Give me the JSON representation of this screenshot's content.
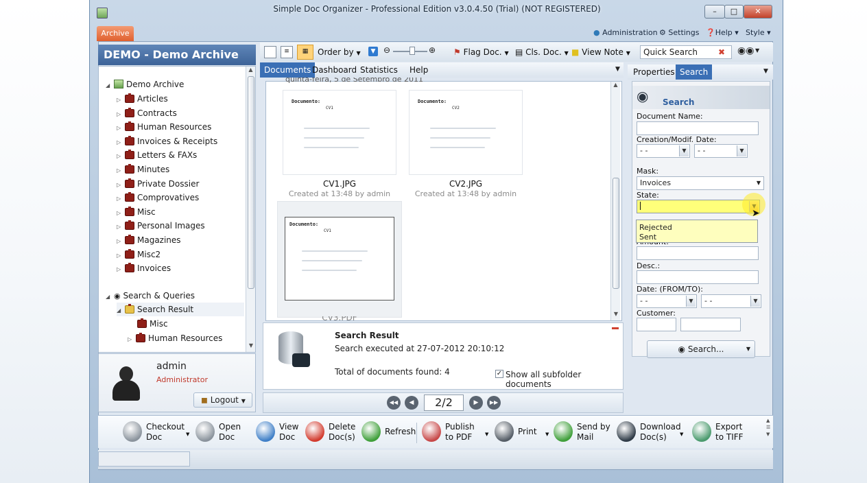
{
  "window": {
    "title": "Simple Doc Organizer - Professional Edition v3.0.4.50 (Trial) (NOT REGISTERED)",
    "controls": [
      "minimize",
      "maximize",
      "close"
    ]
  },
  "archive_tab": "Archive",
  "top_links": {
    "administration": "Administration",
    "settings": "Settings",
    "help": "Help",
    "style": "Style"
  },
  "left": {
    "header": "DEMO - Demo Archive",
    "root": "Demo Archive",
    "folders": [
      "Articles",
      "Contracts",
      "Human Resources",
      "Invoices & Receipts",
      "Letters & FAXs",
      "Minutes",
      "Private Dossier",
      "Comprovatives",
      "Misc",
      "Personal Images",
      "Magazines",
      "Misc2",
      "Invoices"
    ],
    "search_root": "Search & Queries",
    "search_result": "Search Result",
    "search_children": [
      "Misc",
      "Human Resources"
    ]
  },
  "user": {
    "name": "admin",
    "role": "Administrator",
    "logout": "Logout"
  },
  "toolbar": {
    "order_by": "Order by",
    "flag_doc": "Flag Doc.",
    "cls_doc": "Cls. Doc.",
    "view_note": "View Note",
    "quick_search_placeholder": "Quick Search"
  },
  "tabs": [
    "Documents",
    "Dashboard",
    "Statistics",
    "Help"
  ],
  "active_tab": "Documents",
  "group_header": "quinta-feira, 5 de Setembro de 2011",
  "documents": [
    {
      "name": "CV1.JPG",
      "meta": "Created at 13:48 by admin",
      "heading": "Documento:",
      "code": "CV1"
    },
    {
      "name": "CV2.JPG",
      "meta": "Created at 13:48 by admin",
      "heading": "Documento:",
      "code": "CV2"
    },
    {
      "name": "CV3.PDF",
      "meta": "",
      "heading": "Documento:",
      "code": "CV1"
    }
  ],
  "result": {
    "title": "Search Result",
    "executed": "Search executed at 27-07-2012 20:10:12",
    "total": "Total of documents found: 4",
    "show_all": "Show all subfolder documents"
  },
  "pager": {
    "current": "2/2"
  },
  "right": {
    "tabs": [
      "Properties",
      "Search"
    ],
    "active_tab": "Search",
    "title": "Search",
    "document_name": "Document Name:",
    "creation_date": "Creation/Modif. Date:",
    "date_empty": "-  -",
    "mask": "Mask:",
    "mask_value": "Invoices",
    "state": "State:",
    "state_options": [
      "Rejected",
      "Sent"
    ],
    "amount": "Amount:",
    "desc": "Desc.:",
    "date_from_to": "Date: (FROM/TO):",
    "customer": "Customer:",
    "search_button": "Search..."
  },
  "bottom": [
    {
      "l1": "Checkout",
      "l2": "Doc",
      "color": "#8a939c"
    },
    {
      "l1": "Open",
      "l2": "Doc",
      "color": "#8a939c"
    },
    {
      "l1": "View",
      "l2": "Doc",
      "color": "#3f7fc7"
    },
    {
      "l1": "Delete",
      "l2": "Doc(s)",
      "color": "#d23b2e"
    },
    {
      "l1": "Refresh",
      "l2": "",
      "color": "#3f9f3a"
    },
    {
      "l1": "Publish",
      "l2": "to PDF",
      "color": "#c74848"
    },
    {
      "l1": "Print",
      "l2": "",
      "color": "#555d66"
    },
    {
      "l1": "Send by",
      "l2": "Mail",
      "color": "#3f9f3a"
    },
    {
      "l1": "Download",
      "l2": "Doc(s)",
      "color": "#2f3b47"
    },
    {
      "l1": "Export",
      "l2": "to TIFF",
      "color": "#4a9a6d"
    }
  ]
}
